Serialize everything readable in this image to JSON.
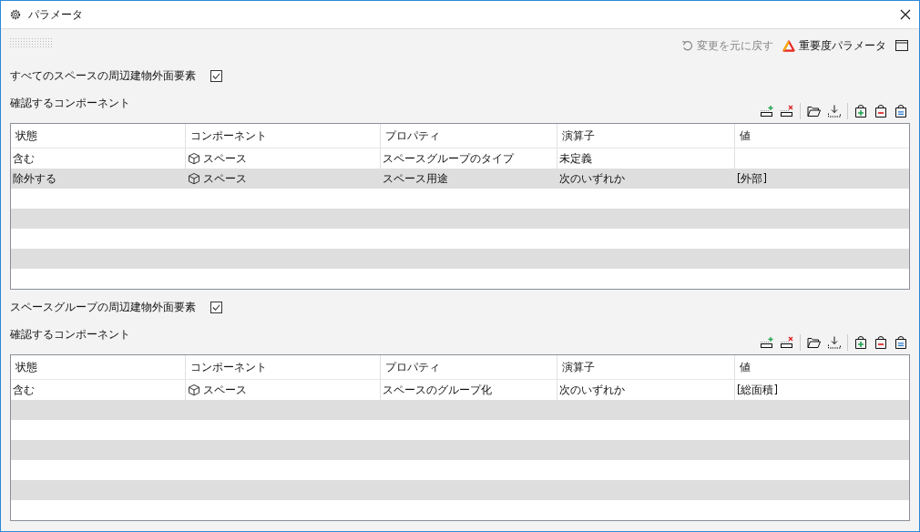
{
  "window": {
    "title": "パラメータ"
  },
  "toolbar": {
    "undo": {
      "label": "変更を元に戻す",
      "disabled": true
    },
    "importance": {
      "label": "重要度パラメータ"
    }
  },
  "sections": [
    {
      "checkbox": {
        "label": "すべてのスペースの周辺建物外面要素",
        "checked": true
      },
      "subtitle": "確認するコンポーネント",
      "table": {
        "columns": [
          "状態",
          "コンポーネント",
          "プロパティ",
          "演算子",
          "値"
        ],
        "rows": [
          {
            "cells": [
              "含む",
              "スペース",
              "スペースグループのタイプ",
              "未定義",
              ""
            ]
          },
          {
            "cells": [
              "除外する",
              "スペース",
              "スペース用途",
              "次のいずれか",
              "[外部]"
            ]
          }
        ]
      }
    },
    {
      "checkbox": {
        "label": "スペースグループの周辺建物外面要素",
        "checked": true
      },
      "subtitle": "確認するコンポーネント",
      "table": {
        "columns": [
          "状態",
          "コンポーネント",
          "プロパティ",
          "演算子",
          "値"
        ],
        "rows": [
          {
            "cells": [
              "含む",
              "スペース",
              "スペースのグループ化",
              "次のいずれか",
              "[総面積]"
            ]
          }
        ]
      }
    }
  ]
}
